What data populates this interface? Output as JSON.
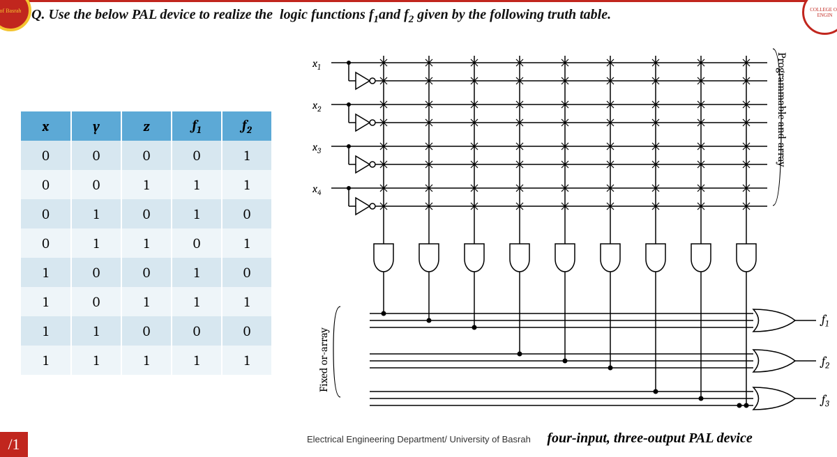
{
  "corner_left_text": "of Basrah",
  "corner_right_text": "COLLEGE OF ENGIN",
  "question_html": "Q. Use the below PAL device to realize the  logic functions f<sub>1</sub>and f<sub>2</sub> given by the following truth table.",
  "truth_table": {
    "headers": [
      "x",
      "y",
      "z",
      "f₁",
      "f₂"
    ],
    "header_subs": [
      "",
      "",
      "",
      "1",
      "2"
    ],
    "header_letters": [
      "x",
      "y",
      "z",
      "f",
      "f"
    ],
    "rows": [
      [
        "0",
        "0",
        "0",
        "0",
        "1"
      ],
      [
        "0",
        "0",
        "1",
        "1",
        "1"
      ],
      [
        "0",
        "1",
        "0",
        "1",
        "0"
      ],
      [
        "0",
        "1",
        "1",
        "0",
        "1"
      ],
      [
        "1",
        "0",
        "0",
        "1",
        "0"
      ],
      [
        "1",
        "0",
        "1",
        "1",
        "1"
      ],
      [
        "1",
        "1",
        "0",
        "0",
        "0"
      ],
      [
        "1",
        "1",
        "1",
        "1",
        "1"
      ]
    ]
  },
  "inputs": [
    "x₁",
    "x₂",
    "x₃",
    "x₄"
  ],
  "outputs": [
    "f₁",
    "f₂",
    "f₃"
  ],
  "programmable_label": "Programmable and-array",
  "fixed_label": "Fixed or-array",
  "footer_dept": "Electrical Engineering Department/ University of Basrah",
  "footer_caption": "four-input, three-output PAL device",
  "page_number": "/1"
}
